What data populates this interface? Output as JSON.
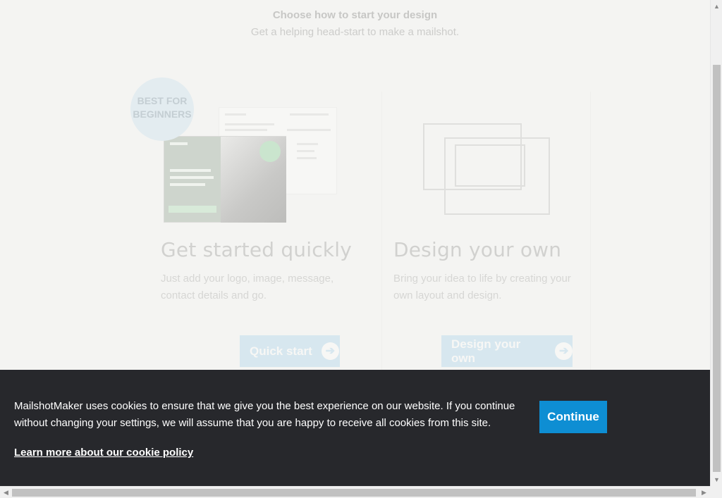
{
  "header": {
    "title": "Choose how to start your design",
    "subtitle": "Get a helping head-start to make a mailshot."
  },
  "badge": {
    "line1": "BEST FOR",
    "line2": "BEGINNERS"
  },
  "quick_start": {
    "title": "Get started quickly",
    "description": "Just add your logo, image, message, contact details and go.",
    "button_label": "Quick start"
  },
  "design_own": {
    "title": "Design your own",
    "description": "Bring your idea to life by creating your own layout and design.",
    "button_label": "Design your own"
  },
  "cookie_banner": {
    "message": "MailshotMaker uses cookies to ensure that we give you the best experience on our website. If you continue without changing your settings, we will assume that you are happy to receive all cookies from this site.",
    "link_label": "Learn more about our cookie policy",
    "continue_label": "Continue"
  },
  "colors": {
    "accent": "#0e8ed3",
    "banner_bg": "#27282c",
    "page_bg": "#f4f4f2"
  }
}
